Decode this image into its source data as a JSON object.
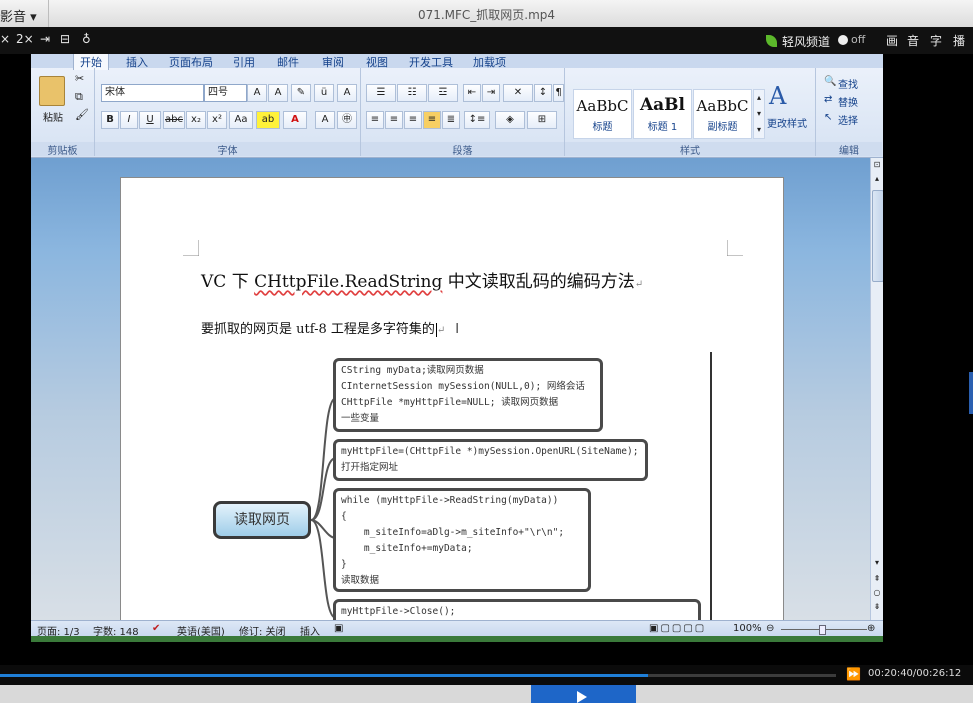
{
  "player": {
    "menu": "影音 ▾",
    "title": "071.MFC_抓取网页.mp4",
    "toolbar_left": [
      "×",
      "2×",
      "⇥",
      "⊟",
      "♁"
    ],
    "channel": "轻风频道",
    "toggle": "off",
    "toolbar_right": [
      "画",
      "音",
      "字",
      "播"
    ],
    "time": "00:20:40/00:26:12",
    "progress_fraction": 0.775
  },
  "ribbon": {
    "tabs": [
      "开始",
      "插入",
      "页面布局",
      "引用",
      "邮件",
      "审阅",
      "视图",
      "开发工具",
      "加载项"
    ],
    "active_tab": "开始",
    "clipboard": {
      "label": "剪贴板",
      "paste": "粘贴"
    },
    "font": {
      "label": "字体",
      "name": "宋体",
      "size": "四号",
      "buttons": [
        "B",
        "I",
        "U",
        "abc",
        "x₂",
        "x²",
        "Aa"
      ]
    },
    "paragraph": {
      "label": "段落"
    },
    "styles": {
      "label": "样式",
      "tiles": [
        {
          "sample": "AaBbC",
          "name": "标题"
        },
        {
          "sample": "AaBl",
          "name": "标题 1"
        },
        {
          "sample": "AaBbC",
          "name": "副标题"
        }
      ],
      "change": "更改样式"
    },
    "editing": {
      "label": "编辑",
      "find": "查找",
      "replace": "替换",
      "select": "选择"
    }
  },
  "document": {
    "title_prefix": "VC 下 ",
    "title_underlined": "CHttpFile.ReadString",
    "title_suffix": " 中文读取乱码的编码方法",
    "line1": "要抓取的网页是 utf-8  工程是多字符集的"
  },
  "mindmap": {
    "root": "读取网页",
    "nodes": [
      [
        "CString myData;读取网页数据",
        "CInternetSession mySession(NULL,0); 网络会话",
        "CHttpFile *myHttpFile=NULL;   读取网页数据",
        "一些变量"
      ],
      [
        "myHttpFile=(CHttpFile *)mySession.OpenURL(SiteName);",
        "打开指定网址"
      ],
      [
        "while (myHttpFile->ReadString(myData))",
        "{",
        "    m_siteInfo=aDlg->m_siteInfo+\"\\r\\n\";",
        "    m_siteInfo+=myData;",
        "}",
        "读取数据"
      ],
      [
        "myHttpFile->Close();"
      ]
    ]
  },
  "statusbar": {
    "page": "页面: 1/3",
    "words": "字数: 148",
    "lang": "英语(美国)",
    "revision": "修订: 关闭",
    "insert": "插入",
    "zoom": "100%"
  },
  "colors": {
    "accent": "#1f7fd8",
    "ribbon_text": "#15428b"
  }
}
